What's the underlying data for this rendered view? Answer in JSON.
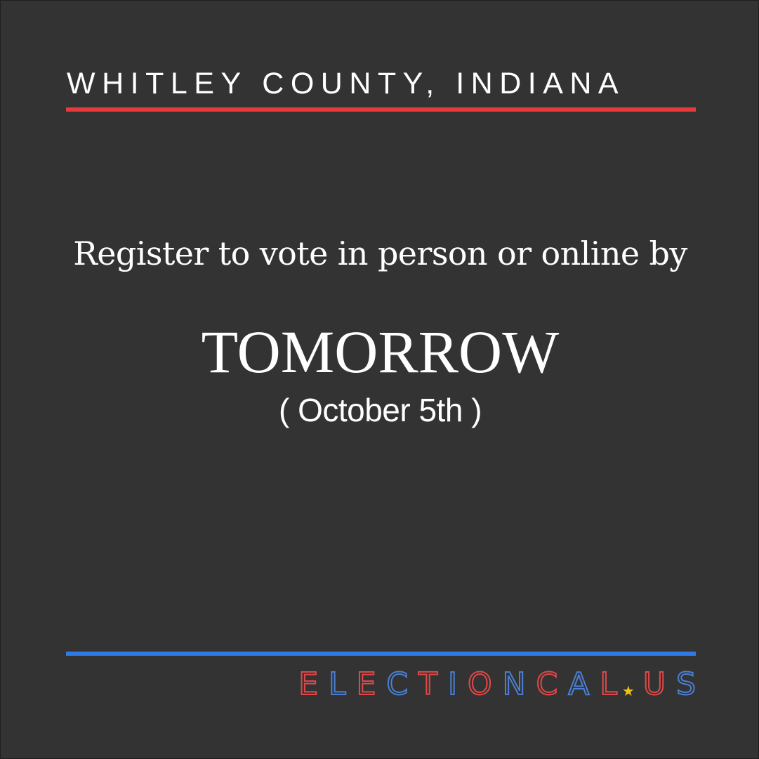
{
  "header": {
    "location": "WHITLEY COUNTY, INDIANA"
  },
  "message": {
    "lead": "Register to vote in person or online by",
    "deadline": "TOMORROW",
    "date": "( October 5th )"
  },
  "brand": {
    "name_part1": "ELECTIONCAL",
    "separator_icon": "star-icon",
    "name_part2": "US"
  },
  "colors": {
    "background": "#333333",
    "red": "#e83a3a",
    "blue": "#2f7ae5",
    "star": "#f2c21b",
    "text": "#ffffff"
  }
}
